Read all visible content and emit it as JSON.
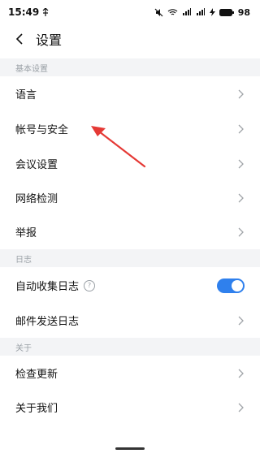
{
  "status_bar": {
    "time": "15:49",
    "battery": "98"
  },
  "header": {
    "title": "设置"
  },
  "sections": [
    {
      "title": "基本设置",
      "items": [
        {
          "label": "语言"
        },
        {
          "label": "帐号与安全"
        },
        {
          "label": "会议设置"
        },
        {
          "label": "网络检测"
        },
        {
          "label": "举报"
        }
      ]
    },
    {
      "title": "日志",
      "items": [
        {
          "label": "自动收集日志",
          "toggle": true
        },
        {
          "label": "邮件发送日志"
        }
      ]
    },
    {
      "title": "关于",
      "items": [
        {
          "label": "检查更新"
        },
        {
          "label": "关于我们"
        }
      ]
    }
  ],
  "colors": {
    "accent": "#2f80ed",
    "annotation": "#e53935"
  }
}
